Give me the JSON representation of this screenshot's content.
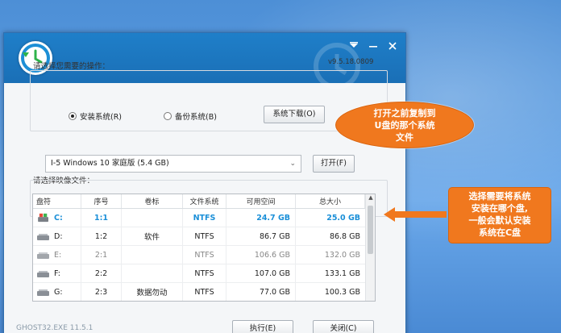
{
  "window": {
    "version": "v9.5.18.0809",
    "icons": [
      "app-logo-icon",
      "menu-icon",
      "minimize-icon",
      "close-icon"
    ]
  },
  "operation": {
    "label": "请选择您需要的操作：",
    "install_label": "安装系统(R)",
    "install_selected": true,
    "backup_label": "备份系统(B)",
    "download_button": "系统下载(O)"
  },
  "image": {
    "label": "请选择映像文件：",
    "selected_value": "I-5 Windows 10 家庭版 (5.4 GB)",
    "open_button": "打开(F)"
  },
  "table": {
    "headers": [
      "盘符",
      "序号",
      "卷标",
      "文件系统",
      "可用空间",
      "总大小"
    ],
    "rows": [
      {
        "drive": "C:",
        "index": "1:1",
        "label": "",
        "fs": "NTFS",
        "free": "24.7 GB",
        "total": "25.0 GB",
        "state": "selected",
        "icon": "system-drive-icon"
      },
      {
        "drive": "D:",
        "index": "1:2",
        "label": "软件",
        "fs": "NTFS",
        "free": "86.7 GB",
        "total": "86.8 GB",
        "state": "normal",
        "icon": "hard-drive-icon"
      },
      {
        "drive": "E:",
        "index": "2:1",
        "label": "",
        "fs": "NTFS",
        "free": "106.6 GB",
        "total": "132.0 GB",
        "state": "dim",
        "icon": "hard-drive-icon"
      },
      {
        "drive": "F:",
        "index": "2:2",
        "label": "",
        "fs": "NTFS",
        "free": "107.0 GB",
        "total": "133.1 GB",
        "state": "normal",
        "icon": "hard-drive-icon"
      },
      {
        "drive": "G:",
        "index": "2:3",
        "label": "数据勿动",
        "fs": "NTFS",
        "free": "77.0 GB",
        "total": "100.3 GB",
        "state": "normal",
        "icon": "hard-drive-icon"
      }
    ]
  },
  "footer": {
    "exe_name": "GHOST32.EXE 11.5.1",
    "execute_button": "执行(E)",
    "close_button": "关闭(C)"
  },
  "callouts": {
    "image_note_lines": [
      "打开之前复制到",
      "U盘的那个系统",
      "文件"
    ],
    "drive_note_lines": [
      "选择需要将系统",
      "安装在哪个盘,",
      "一般会默认安装",
      "系统在C盘"
    ]
  },
  "colors": {
    "accent_orange": "#f0781e",
    "title_blue": "#1f7fc9",
    "selected_blue": "#1a8fd8"
  }
}
